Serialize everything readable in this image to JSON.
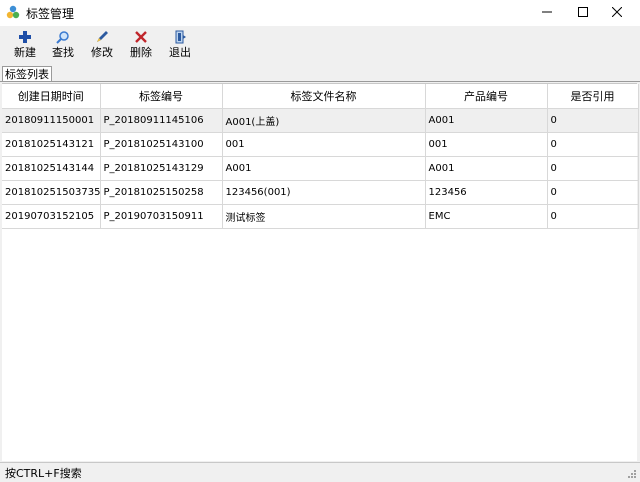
{
  "window": {
    "title": "标签管理",
    "minimize_glyph": "─",
    "maximize_glyph": "☐",
    "close_glyph": "✕"
  },
  "toolbar": [
    {
      "name": "new-button",
      "icon": "plus-icon",
      "label": "新建",
      "color": "#1f4fa8"
    },
    {
      "name": "search-button",
      "icon": "magnifier-icon",
      "label": "查找",
      "color": "#3a7ad0"
    },
    {
      "name": "edit-button",
      "icon": "pen-icon",
      "label": "修改",
      "color": "#2c5aa0"
    },
    {
      "name": "delete-button",
      "icon": "x-icon",
      "label": "删除",
      "color": "#c0262b"
    },
    {
      "name": "exit-button",
      "icon": "door-exit-icon",
      "label": "退出",
      "color": "#2c5aa0"
    }
  ],
  "tab": {
    "label": "标签列表"
  },
  "table": {
    "columns": [
      "创建日期时间",
      "标签编号",
      "标签文件名称",
      "产品编号",
      "是否引用"
    ],
    "rows": [
      [
        "20180911150001",
        "P_20180911145106",
        "A001(上盖)",
        "A001",
        "0"
      ],
      [
        "20181025143121",
        "P_20181025143100",
        "001",
        "001",
        "0"
      ],
      [
        "20181025143144",
        "P_20181025143129",
        "A001",
        "A001",
        "0"
      ],
      [
        "201810251503735",
        "P_20181025150258",
        "123456(001)",
        "123456",
        "0"
      ],
      [
        "20190703152105",
        "P_20190703150911",
        "测试标签",
        "EMC",
        "0"
      ]
    ],
    "selected_row": 0
  },
  "status": {
    "text": "按CTRL+F搜索"
  }
}
